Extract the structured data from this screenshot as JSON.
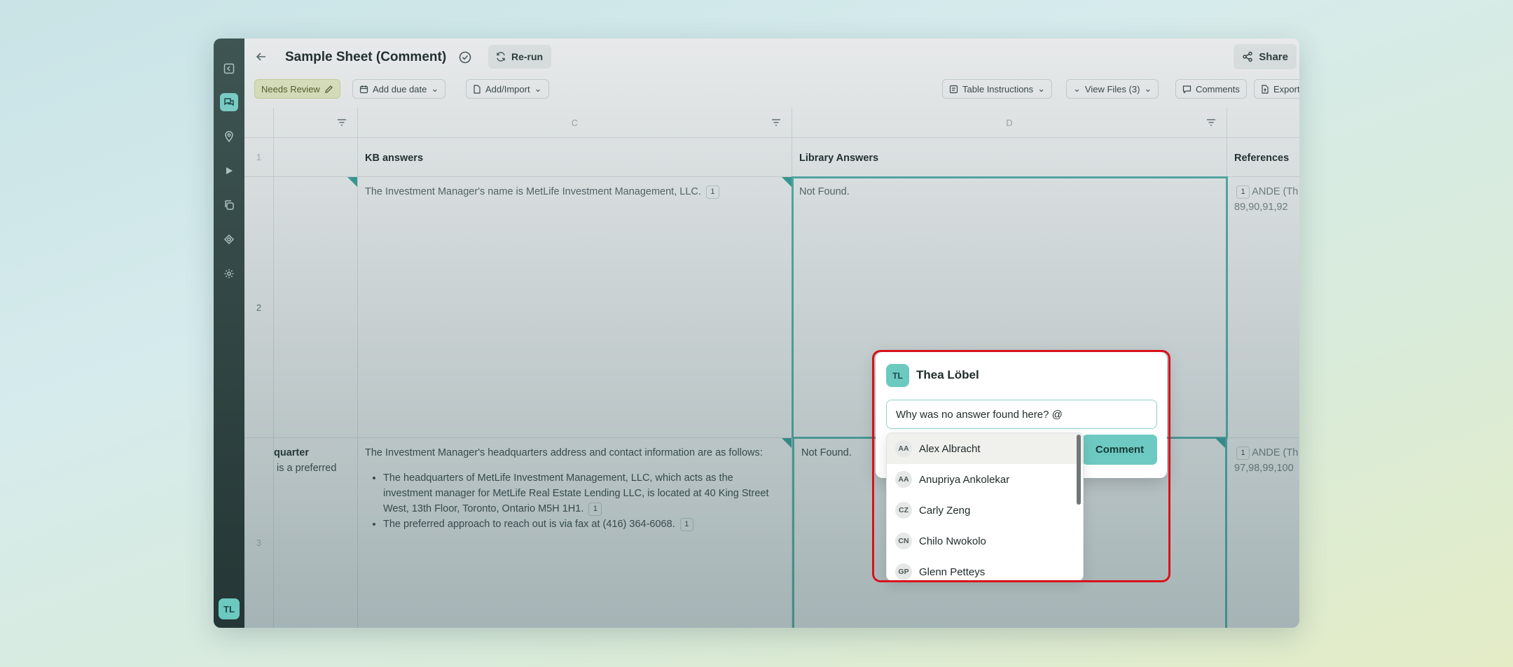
{
  "colors": {
    "accent": "#6dcac2",
    "highlight_frame": "#d8121c",
    "rail": "#2c403f"
  },
  "sidebar": {
    "icons": [
      "collapse-icon",
      "chat-icon",
      "location-pin-icon",
      "play-icon",
      "copy-icon",
      "brain-icon",
      "settings-icon"
    ],
    "user_initials": "TL"
  },
  "header": {
    "title": "Sample Sheet (Comment)",
    "rerun_label": "Re-run",
    "share_label": "Share"
  },
  "toolbar": {
    "needs_review": "Needs Review",
    "due_date": "Add due date",
    "add_import": "Add/Import",
    "table_instructions": "Table Instructions",
    "view_files": "View Files (3)",
    "comments": "Comments",
    "export": "Export"
  },
  "grid": {
    "col_letters": [
      "C",
      "D"
    ],
    "headers": {
      "kb": "KB answers",
      "library": "Library Answers",
      "references": "References"
    },
    "row_numbers": [
      "1",
      "2",
      "3"
    ],
    "rows": [
      {
        "b_text": "",
        "kb_answer": "The Investment Manager's name is MetLife Investment Management, LLC.",
        "kb_badge": "1",
        "library": "Not Found.",
        "ref_badge": "1",
        "ref_text": "ANDE (Th",
        "ref_pages": "89,90,91,92"
      },
      {
        "b_text_1": "quarter",
        "b_text_2": "is a preferred",
        "kb_intro": "The Investment Manager's headquarters address and contact information are as follows:",
        "kb_bullet_1": "The headquarters of MetLife Investment Management, LLC, which acts as the investment manager for MetLife Real Estate Lending LLC, is located at 40 King Street West, 13th Floor, Toronto, Ontario M5H 1H1.",
        "kb_bullet_2": "The preferred approach to reach out is via fax at (416) 364-6068.",
        "kb_badge": "1",
        "library": "Not Found.",
        "ref_badge": "1",
        "ref_text": "ANDE (Th",
        "ref_pages": "97,98,99,100"
      }
    ]
  },
  "comment_popup": {
    "author_initials": "TL",
    "author_name": "Thea Löbel",
    "input_value": "Why was no answer found here? @",
    "submit_label": "Comment"
  },
  "mention_dropdown": {
    "items": [
      {
        "initials": "AA",
        "name": "Alex Albracht"
      },
      {
        "initials": "AA",
        "name": "Anupriya Ankolekar"
      },
      {
        "initials": "CZ",
        "name": "Carly Zeng"
      },
      {
        "initials": "CN",
        "name": "Chilo Nwokolo"
      },
      {
        "initials": "GP",
        "name": "Glenn Petteys"
      }
    ]
  }
}
